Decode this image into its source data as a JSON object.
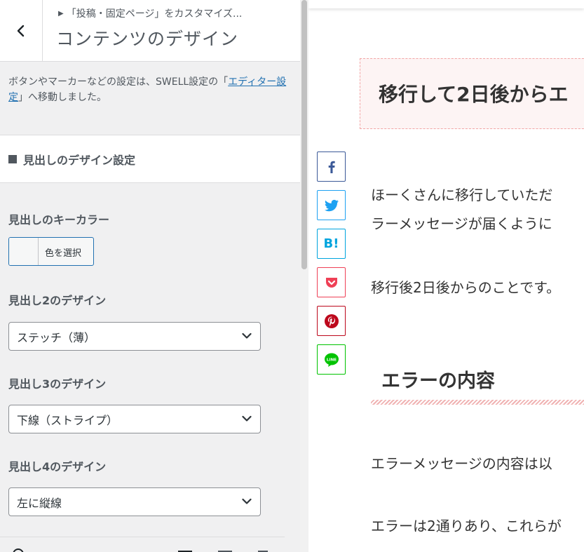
{
  "sidebar": {
    "breadcrumb": "「投稿・固定ページ」をカスタマイズ...",
    "title": "コンテンツのデザイン",
    "notice": {
      "before": "ボタンやマーカーなどの設定は、SWELL設定の「",
      "link": "エディター設定",
      "after": "」へ移動しました。"
    },
    "section_heading": "見出しのデザイン設定",
    "key_color": {
      "label": "見出しのキーカラー",
      "button": "色を選択"
    },
    "h2_design": {
      "label": "見出し2のデザイン",
      "value": "ステッチ（薄）"
    },
    "h3_design": {
      "label": "見出し3のデザイン",
      "value": "下線（ストライプ）"
    },
    "h4_design": {
      "label": "見出し4のデザイン",
      "value": "左に縦線"
    }
  },
  "preview": {
    "h2": "移行して2日後からエ",
    "paragraph1_line1": "ほーくさんに移行していただ",
    "paragraph1_line2": "ラーメッセージが届くように",
    "paragraph2": "移行後2日後からのことです。",
    "h3": "エラーの内容",
    "paragraph3": "エラーメッセージの内容は以",
    "paragraph4": "エラーは2通りあり、これらが",
    "share": {
      "hatena_label": "B!",
      "line_label": "LINE"
    }
  },
  "colors": {
    "accent": "#2271b1",
    "facebook": "#3b5998",
    "twitter": "#1da1f2",
    "hatena": "#00a4de",
    "pocket": "#ef4056",
    "pinterest": "#bd081c",
    "line": "#00c300",
    "h2_border": "#f2a5a5"
  },
  "icons": [
    "back-arrow-icon",
    "chevron-down-icon",
    "facebook-icon",
    "twitter-icon",
    "hatena-icon",
    "pocket-icon",
    "pinterest-icon",
    "line-icon"
  ]
}
